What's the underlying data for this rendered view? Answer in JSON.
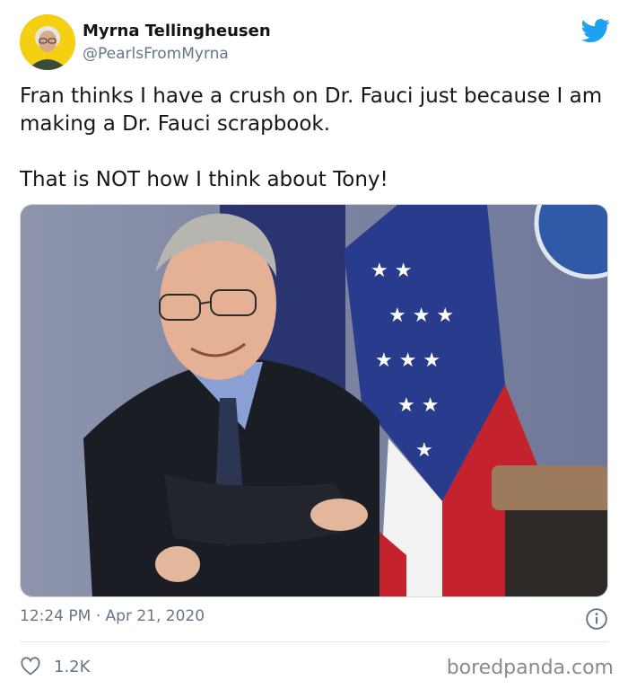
{
  "user": {
    "display_name": "Myrna Tellingheusen",
    "handle": "@PearlsFromMyrna",
    "avatar_icon": "profile-photo-avatar"
  },
  "tweet": {
    "line1": "Fran thinks I have a crush on Dr. Fauci just because I am making a Dr. Fauci scrapbook.",
    "line2": "That is NOT how I think about Tony!"
  },
  "meta": {
    "timestamp": "12:24 PM · Apr 21, 2020"
  },
  "engagement": {
    "likes": "1.2K"
  },
  "watermark": "boredpanda.com",
  "icons": {
    "brand": "twitter-bird-icon",
    "info": "info-icon",
    "like": "heart-icon"
  },
  "colors": {
    "twitter_blue": "#1da1f2",
    "muted_text": "#657786",
    "avatar_bg": "#f5cf12"
  }
}
